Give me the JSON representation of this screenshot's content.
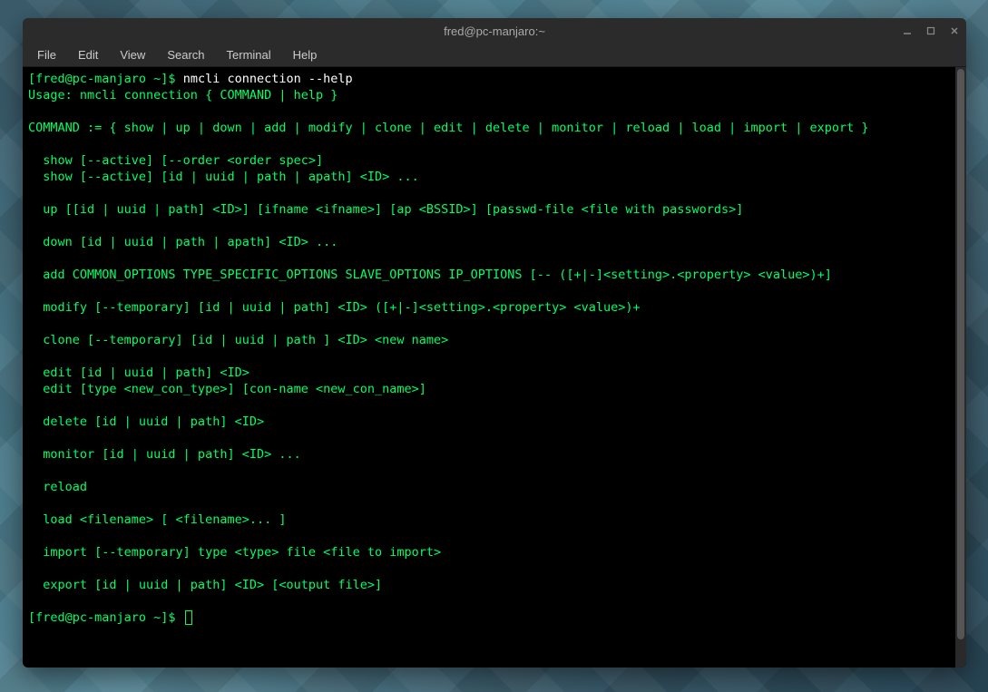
{
  "window": {
    "title": "fred@pc-manjaro:~"
  },
  "menubar": {
    "items": [
      "File",
      "Edit",
      "View",
      "Search",
      "Terminal",
      "Help"
    ]
  },
  "terminal": {
    "prompt1": "[fred@pc-manjaro ~]$ ",
    "command1": "nmcli connection --help",
    "lines": [
      "Usage: nmcli connection { COMMAND | help }",
      "",
      "COMMAND := { show | up | down | add | modify | clone | edit | delete | monitor | reload | load | import | export }",
      "",
      "  show [--active] [--order <order spec>]",
      "  show [--active] [id | uuid | path | apath] <ID> ...",
      "",
      "  up [[id | uuid | path] <ID>] [ifname <ifname>] [ap <BSSID>] [passwd-file <file with passwords>]",
      "",
      "  down [id | uuid | path | apath] <ID> ...",
      "",
      "  add COMMON_OPTIONS TYPE_SPECIFIC_OPTIONS SLAVE_OPTIONS IP_OPTIONS [-- ([+|-]<setting>.<property> <value>)+]",
      "",
      "  modify [--temporary] [id | uuid | path] <ID> ([+|-]<setting>.<property> <value>)+",
      "",
      "  clone [--temporary] [id | uuid | path ] <ID> <new name>",
      "",
      "  edit [id | uuid | path] <ID>",
      "  edit [type <new_con_type>] [con-name <new_con_name>]",
      "",
      "  delete [id | uuid | path] <ID>",
      "",
      "  monitor [id | uuid | path] <ID> ...",
      "",
      "  reload",
      "",
      "  load <filename> [ <filename>... ]",
      "",
      "  import [--temporary] type <type> file <file to import>",
      "",
      "  export [id | uuid | path] <ID> [<output file>]",
      ""
    ],
    "prompt2": "[fred@pc-manjaro ~]$ "
  }
}
